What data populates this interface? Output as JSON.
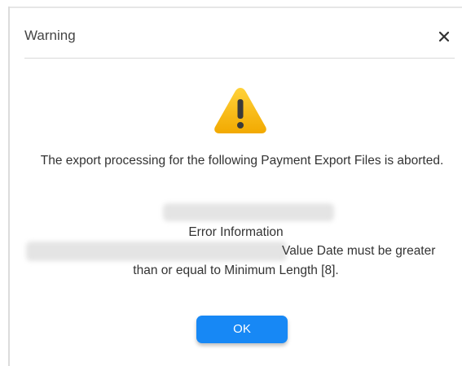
{
  "dialog": {
    "title": "Warning",
    "close_icon": "close-icon",
    "warning_icon": "warning-triangle-icon",
    "message": "The export processing for the following Payment Export Files is aborted.",
    "error_heading": "Error Information",
    "error_detail_line1": "Value Date must be greater",
    "error_detail_line2": "than or equal to Minimum Length [8].",
    "ok_label": "OK"
  },
  "colors": {
    "accent": "#1788f5",
    "warning": "#f5b400",
    "text": "#333333"
  }
}
